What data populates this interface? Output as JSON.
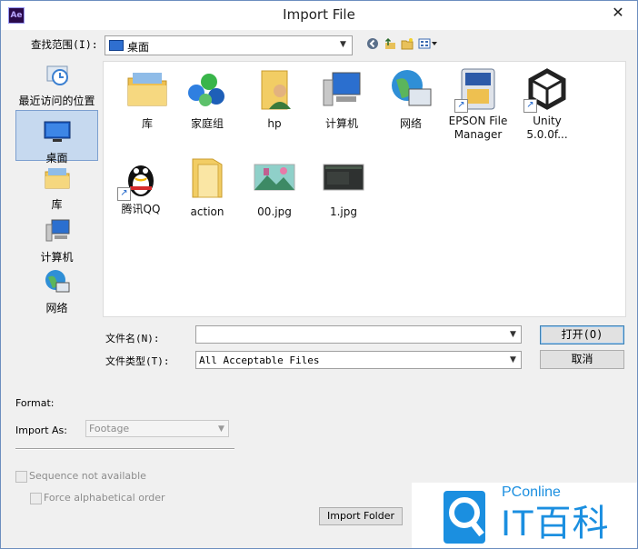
{
  "window": {
    "title": "Import File",
    "app_icon_text": "Ae",
    "close_glyph": "✕"
  },
  "look_in": {
    "label": "查找范围(I):",
    "value": "桌面",
    "icon": "desktop-icon"
  },
  "toolbar": {
    "icons": [
      "back-icon",
      "up-folder-icon",
      "new-folder-icon",
      "view-menu-icon"
    ]
  },
  "places": [
    {
      "label": "最近访问的位置",
      "icon": "recent-places-icon"
    },
    {
      "label": "桌面",
      "icon": "desktop-icon",
      "selected": true
    },
    {
      "label": "库",
      "icon": "libraries-icon"
    },
    {
      "label": "计算机",
      "icon": "computer-icon"
    },
    {
      "label": "网络",
      "icon": "network-icon"
    }
  ],
  "files": [
    {
      "label": "库",
      "icon": "libraries-icon"
    },
    {
      "label": "家庭组",
      "icon": "homegroup-icon"
    },
    {
      "label": "hp",
      "icon": "user-folder-icon"
    },
    {
      "label": "计算机",
      "icon": "computer-icon"
    },
    {
      "label": "网络",
      "icon": "network-icon"
    },
    {
      "label": "EPSON File Manager",
      "icon": "epson-shortcut-icon"
    },
    {
      "label": "Unity 5.0.0f...",
      "icon": "unity-shortcut-icon"
    },
    {
      "label": "腾讯QQ",
      "icon": "qq-shortcut-icon"
    },
    {
      "label": "action",
      "icon": "folder-icon"
    },
    {
      "label": "00.jpg",
      "icon": "image-thumbnail-icon"
    },
    {
      "label": "1.jpg",
      "icon": "image-thumbnail-icon"
    }
  ],
  "file_name": {
    "label": "文件名(N):",
    "value": ""
  },
  "file_type": {
    "label": "文件类型(T):",
    "value": "All Acceptable Files"
  },
  "buttons": {
    "open": "打开(O)",
    "cancel": "取消",
    "import_folder": "Import Folder"
  },
  "options": {
    "format_label": "Format:",
    "import_as_label": "Import As:",
    "import_as_value": "Footage",
    "sequence_label": "Sequence not available",
    "force_alpha_label": "Force alphabetical order"
  },
  "watermark": {
    "brand_top": "PConline",
    "brand_main": "IT百科"
  },
  "colors": {
    "accent": "#1b8fe0",
    "selection": "#c6d9ef",
    "title_bar": "#ffffff"
  }
}
